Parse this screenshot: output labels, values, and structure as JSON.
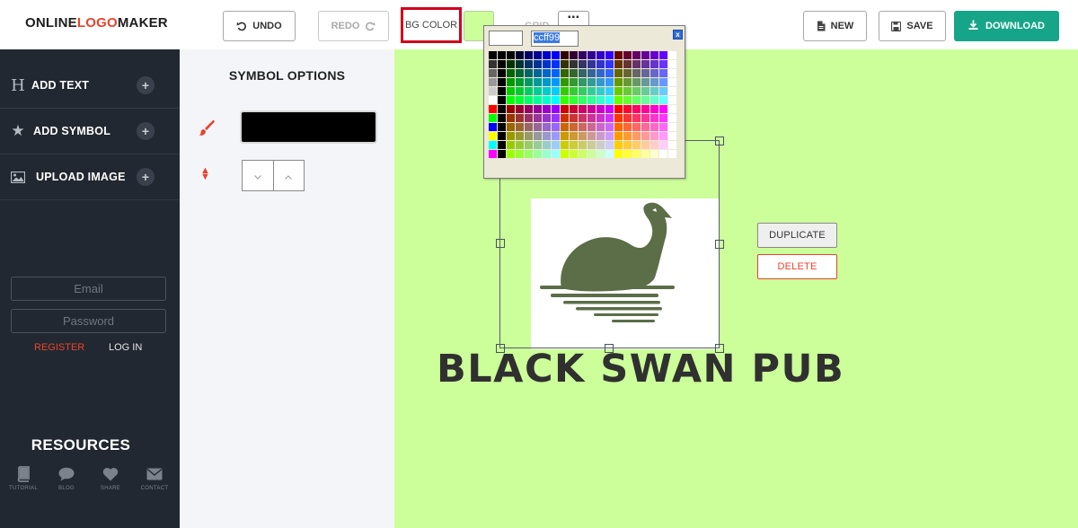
{
  "app": {
    "logo": {
      "part1": "ONLINE",
      "part2": "LOGO",
      "part3": "MAKER"
    }
  },
  "toolbar": {
    "undo_label": "UNDO",
    "redo_label": "REDO",
    "bg_color_label": "BG COLOR",
    "bg_color_value": "#ccff99",
    "grid_label": "GRID",
    "new_label": "NEW",
    "save_label": "SAVE",
    "download_label": "DOWNLOAD",
    "accent_color": "#17a589"
  },
  "sidebar": {
    "items": [
      {
        "label": "ADD TEXT",
        "icon": "heading-icon"
      },
      {
        "label": "ADD SYMBOL",
        "icon": "star-icon"
      },
      {
        "label": "UPLOAD IMAGE",
        "icon": "image-icon"
      }
    ],
    "email_placeholder": "Email",
    "password_placeholder": "Password",
    "register_label": "REGISTER",
    "login_label": "LOG IN",
    "resources_title": "RESOURCES",
    "resources": [
      {
        "label": "TUTORIAL",
        "icon": "book-icon"
      },
      {
        "label": "BLOG",
        "icon": "chat-icon"
      },
      {
        "label": "SHARE",
        "icon": "heart-icon"
      },
      {
        "label": "CONTACT",
        "icon": "envelope-icon"
      }
    ]
  },
  "options": {
    "title": "SYMBOL OPTIONS",
    "symbol_color": "#000000"
  },
  "color_picker": {
    "hex_value": "ccff99",
    "close_label": "x"
  },
  "canvas": {
    "background": "#ccff99",
    "logo_text": "BLACK SWAN PUB",
    "swan_color": "#5b6e47",
    "duplicate_label": "DUPLICATE",
    "delete_label": "DELETE"
  }
}
